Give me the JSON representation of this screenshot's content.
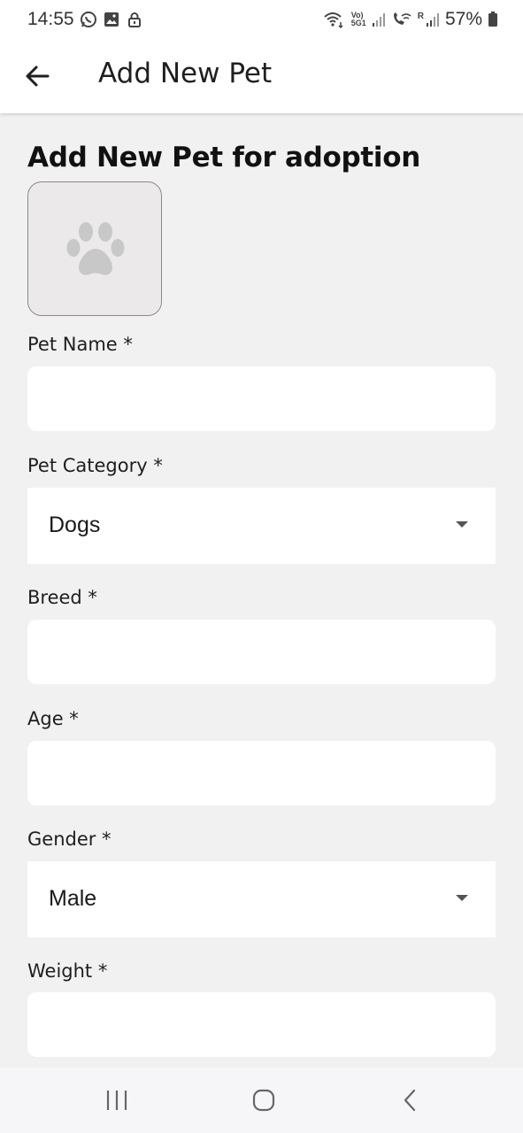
{
  "status_bar": {
    "time": "14:55",
    "battery": "57%",
    "icons": [
      "whatsapp-icon",
      "gallery-icon",
      "lock-icon",
      "wifi-icon",
      "volte-icon",
      "signal-icon",
      "wifi-calling-icon",
      "signal-icon",
      "battery-icon"
    ],
    "signal_labels": {
      "volte_top": "Vo)",
      "volte_bottom": "5G1",
      "roaming": "R"
    }
  },
  "app_bar": {
    "back_icon": "arrow-left-icon",
    "title": "Add New Pet"
  },
  "form": {
    "heading": "Add New Pet for adoption",
    "image_picker_icon": "paw-icon",
    "fields": {
      "pet_name": {
        "label": "Pet Name *",
        "value": ""
      },
      "pet_category": {
        "label": "Pet Category *",
        "value": "Dogs"
      },
      "breed": {
        "label": "Breed *",
        "value": ""
      },
      "age": {
        "label": "Age *",
        "value": ""
      },
      "gender": {
        "label": "Gender *",
        "value": "Male"
      },
      "weight": {
        "label": "Weight *",
        "value": ""
      }
    }
  },
  "nav_bar": {
    "icons": [
      "recent-apps-icon",
      "home-icon",
      "back-nav-icon"
    ]
  },
  "colors": {
    "background": "#f1f1f1",
    "surface": "#ffffff",
    "image_picker_bg": "#ece9ea",
    "paw": "#c8c8c8"
  }
}
